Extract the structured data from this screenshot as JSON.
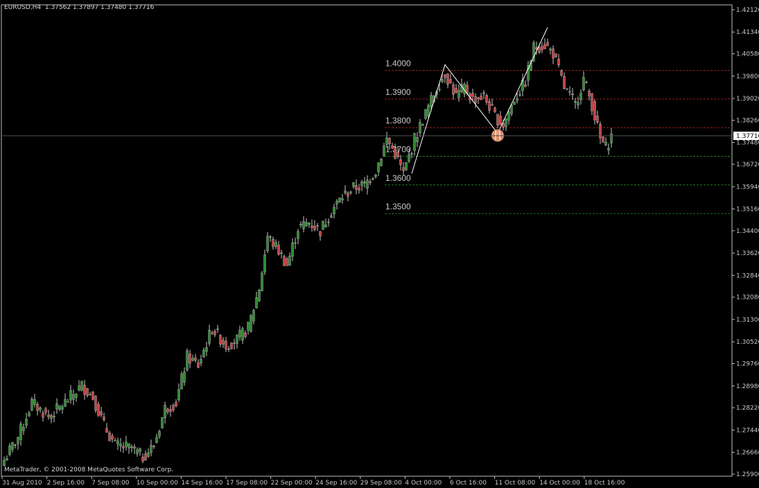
{
  "header": {
    "symbol": "EURUSD,H4",
    "open": "1.37562",
    "high": "1.37897",
    "low": "1.37480",
    "close": "1.37716"
  },
  "copyright": "MetaTrader, © 2001-2008 MetaQuotes Software Corp.",
  "colors": {
    "background": "#000000",
    "frame": "#c0c0c0",
    "bull_candle": "#2d8a2d",
    "bear_candle": "#c84040",
    "wick": "#c8c8c8",
    "resistance_line": "#a01e1e",
    "support_line": "#1e7a1e",
    "zigzag": "#ffffff",
    "marker": "#f4a07a",
    "label_text": "#c8c8c8",
    "price_badge_bg": "#ffffff",
    "price_badge_text": "#000000"
  },
  "chart_data": {
    "type": "candlestick",
    "symbol": "EURUSD",
    "timeframe": "H4",
    "y_axis_ticks": [
      "1.42120",
      "1.41340",
      "1.40580",
      "1.39800",
      "1.39020",
      "1.38260",
      "1.37480",
      "1.36720",
      "1.35940",
      "1.35160",
      "1.34400",
      "1.33620",
      "1.32840",
      "1.32080",
      "1.31300",
      "1.30520",
      "1.29760",
      "1.28980",
      "1.28220",
      "1.27440",
      "1.26660",
      "1.25900"
    ],
    "current_price": "1.37716",
    "x_axis_labels": [
      "31 Aug 2010",
      "2 Sep 16:00",
      "7 Sep 08:00",
      "10 Sep 00:00",
      "14 Sep 16:00",
      "17 Sep 08:00",
      "22 Sep 00:00",
      "24 Sep 16:00",
      "29 Sep 08:00",
      "4 Oct 00:00",
      "6 Oct 16:00",
      "11 Oct 08:00",
      "14 Oct 00:00",
      "18 Oct 16:00"
    ],
    "y_range": [
      1.259,
      1.4212
    ],
    "levels": [
      {
        "label": "1.4000",
        "price": 1.4,
        "kind": "resistance"
      },
      {
        "label": "1.3900",
        "price": 1.39,
        "kind": "resistance"
      },
      {
        "label": "1.3800",
        "price": 1.38,
        "kind": "resistance"
      },
      {
        "label": "1.3700",
        "price": 1.37,
        "kind": "support"
      },
      {
        "label": "1.3600",
        "price": 1.36,
        "kind": "support"
      },
      {
        "label": "1.3500",
        "price": 1.35,
        "kind": "support"
      }
    ],
    "anchors": [
      [
        0,
        1.264
      ],
      [
        5,
        1.272
      ],
      [
        10,
        1.284
      ],
      [
        16,
        1.279
      ],
      [
        22,
        1.284
      ],
      [
        28,
        1.29
      ],
      [
        32,
        1.286
      ],
      [
        36,
        1.276
      ],
      [
        40,
        1.269
      ],
      [
        46,
        1.268
      ],
      [
        50,
        1.265
      ],
      [
        54,
        1.269
      ],
      [
        58,
        1.282
      ],
      [
        62,
        1.284
      ],
      [
        66,
        1.3
      ],
      [
        70,
        1.297
      ],
      [
        75,
        1.31
      ],
      [
        80,
        1.304
      ],
      [
        84,
        1.306
      ],
      [
        88,
        1.31
      ],
      [
        92,
        1.324
      ],
      [
        95,
        1.342
      ],
      [
        99,
        1.337
      ],
      [
        102,
        1.332
      ],
      [
        106,
        1.345
      ],
      [
        110,
        1.347
      ],
      [
        114,
        1.344
      ],
      [
        118,
        1.351
      ],
      [
        122,
        1.356
      ],
      [
        126,
        1.359
      ],
      [
        130,
        1.36
      ],
      [
        134,
        1.365
      ],
      [
        138,
        1.376
      ],
      [
        141,
        1.371
      ],
      [
        144,
        1.364
      ],
      [
        148,
        1.376
      ],
      [
        152,
        1.385
      ],
      [
        156,
        1.394
      ],
      [
        159,
        1.399
      ],
      [
        163,
        1.391
      ],
      [
        166,
        1.394
      ],
      [
        169,
        1.39
      ],
      [
        173,
        1.391
      ],
      [
        177,
        1.384
      ],
      [
        180,
        1.381
      ],
      [
        184,
        1.39
      ],
      [
        188,
        1.396
      ],
      [
        191,
        1.408
      ],
      [
        195,
        1.409
      ],
      [
        198,
        1.406
      ],
      [
        202,
        1.394
      ],
      [
        206,
        1.388
      ],
      [
        209,
        1.397
      ],
      [
        212,
        1.388
      ],
      [
        215,
        1.376
      ],
      [
        217,
        1.373
      ],
      [
        219,
        1.377
      ]
    ],
    "zigzag": [
      [
        147,
        1.364
      ],
      [
        159,
        1.402
      ],
      [
        178,
        1.378
      ],
      [
        196,
        1.415
      ]
    ],
    "marker": [
      178,
      1.378
    ]
  }
}
